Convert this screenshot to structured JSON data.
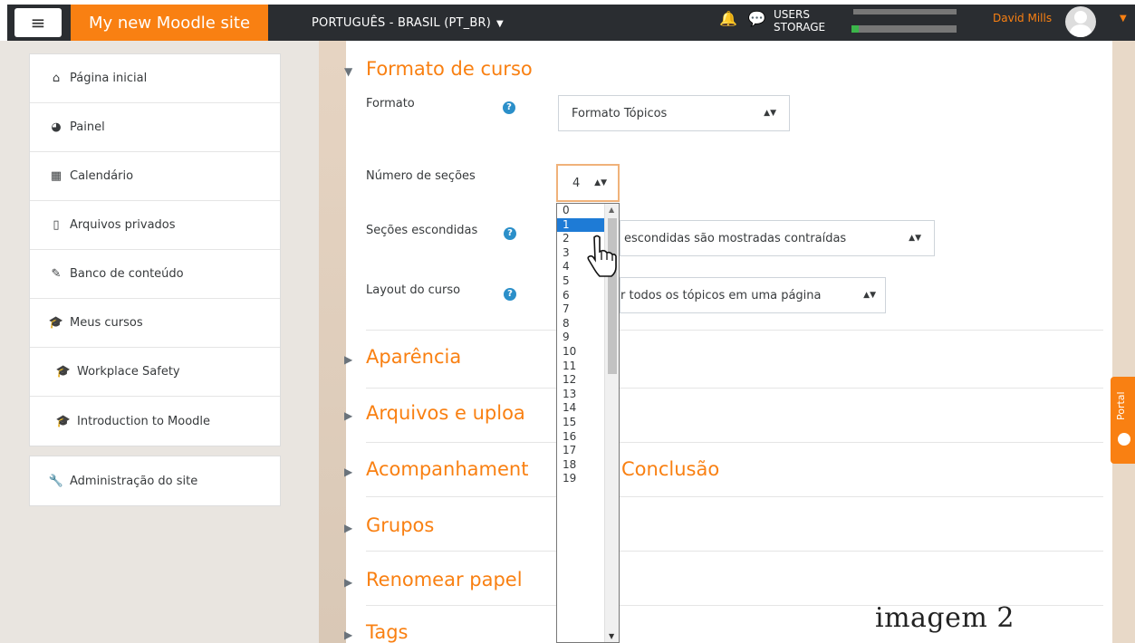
{
  "navbar": {
    "menu_icon": "hamburger-icon",
    "brand": "My new Moodle site",
    "language": "PORTUGUÊS - BRASIL (PT_BR)",
    "storage_line1": "USERS",
    "storage_line2": "STORAGE",
    "user_name": "David Mills"
  },
  "sidebar": {
    "items": [
      {
        "label": "Página inicial",
        "icon": "home-icon"
      },
      {
        "label": "Painel",
        "icon": "dashboard-icon"
      },
      {
        "label": "Calendário",
        "icon": "calendar-icon"
      },
      {
        "label": "Arquivos privados",
        "icon": "file-icon"
      },
      {
        "label": "Banco de conteúdo",
        "icon": "brush-icon"
      },
      {
        "label": "Meus cursos",
        "icon": "graduation-cap-icon"
      },
      {
        "label": "Workplace Safety",
        "icon": "graduation-cap-icon"
      },
      {
        "label": "Introduction to Moodle",
        "icon": "graduation-cap-icon"
      }
    ],
    "admin": {
      "label": "Administração do site",
      "icon": "wrench-icon"
    }
  },
  "main": {
    "section_title": "Formato de curso",
    "fields": {
      "format_label": "Formato",
      "format_value": "Formato Tópicos",
      "sections_label": "Número de seções",
      "sections_value": "4",
      "hidden_label": "Seções escondidas",
      "hidden_value": "escondidas são mostradas contraídas",
      "layout_label": "Layout do curso",
      "layout_value": "r todos os tópicos em uma página"
    },
    "collapsed_sections": [
      "Aparência",
      "Arquivos e uploa",
      "Acompanhament",
      "Conclusão",
      "Grupos",
      "Renomear papel",
      "Tags"
    ]
  },
  "dropdown": {
    "options": [
      "0",
      "1",
      "2",
      "3",
      "4",
      "5",
      "6",
      "7",
      "8",
      "9",
      "10",
      "11",
      "12",
      "13",
      "14",
      "15",
      "16",
      "17",
      "18",
      "19"
    ],
    "highlighted_option": "1"
  },
  "portal_tab": "Portal",
  "caption": "imagem 2"
}
